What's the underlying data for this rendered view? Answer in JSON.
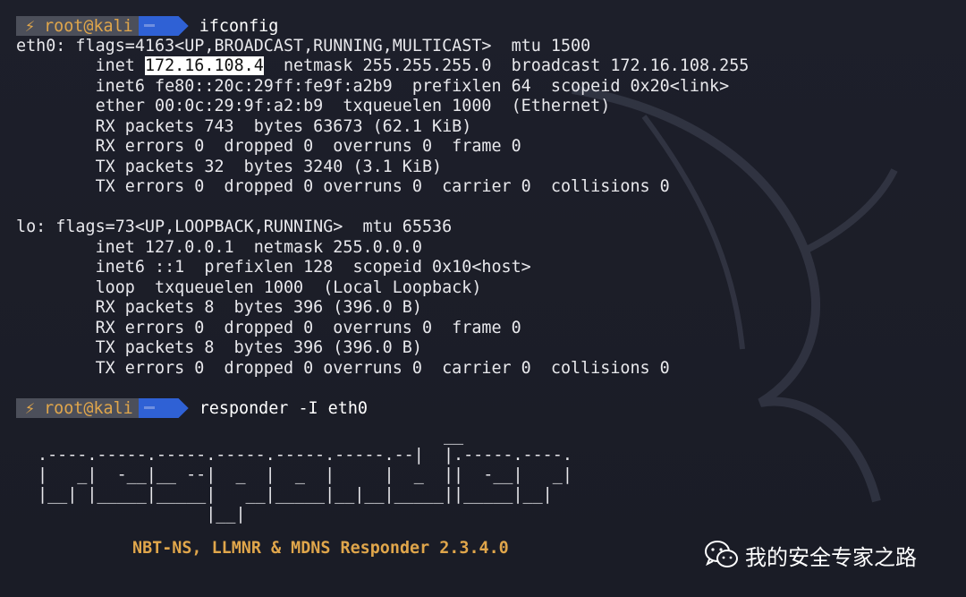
{
  "prompt": {
    "bolt_icon": "lightning-icon",
    "user": "root@kali",
    "arrow_icon": "arrow-right-icon"
  },
  "commands": [
    "ifconfig",
    "responder -I eth0"
  ],
  "ifconfig": {
    "eth0": {
      "header": "eth0: flags=4163<UP,BROADCAST,RUNNING,MULTICAST>  mtu 1500",
      "inet_prefix": "        inet ",
      "inet_ip": "172.16.108.4",
      "inet_suffix": "  netmask 255.255.255.0  broadcast 172.16.108.255",
      "lines": [
        "        inet6 fe80::20c:29ff:fe9f:a2b9  prefixlen 64  scopeid 0x20<link>",
        "        ether 00:0c:29:9f:a2:b9  txqueuelen 1000  (Ethernet)",
        "        RX packets 743  bytes 63673 (62.1 KiB)",
        "        RX errors 0  dropped 0  overruns 0  frame 0",
        "        TX packets 32  bytes 3240 (3.1 KiB)",
        "        TX errors 0  dropped 0 overruns 0  carrier 0  collisions 0"
      ]
    },
    "lo": {
      "header": "lo: flags=73<UP,LOOPBACK,RUNNING>  mtu 65536",
      "lines": [
        "        inet 127.0.0.1  netmask 255.0.0.0",
        "        inet6 ::1  prefixlen 128  scopeid 0x10<host>",
        "        loop  txqueuelen 1000  (Local Loopback)",
        "        RX packets 8  bytes 396 (396.0 B)",
        "        RX errors 0  dropped 0  overruns 0  frame 0",
        "        TX packets 8  bytes 396 (396.0 B)",
        "        TX errors 0  dropped 0 overruns 0  carrier 0  collisions 0"
      ]
    }
  },
  "responder_ascii": "                                         __\n.----.-----.-----.-----.-----.-----.--|  |.-----.----.\n|   _|  -__|__ --|  _  |  _  |     |  _  ||  -__|   _|\n|__| |_____|_____|   __|_____|__|__|_____||_____|__|\n                 |__|",
  "responder_banner": "NBT-NS, LLMNR & MDNS Responder 2.3.4.0",
  "watermark": {
    "icon": "wechat-icon",
    "text": "我的安全专家之路"
  },
  "colors": {
    "background": "#1b1d27",
    "prompt_segment": "#4c4f5a",
    "prompt_user": "#e0a64b",
    "prompt_arrow": "#2f61d5",
    "banner": "#e0a64b"
  }
}
